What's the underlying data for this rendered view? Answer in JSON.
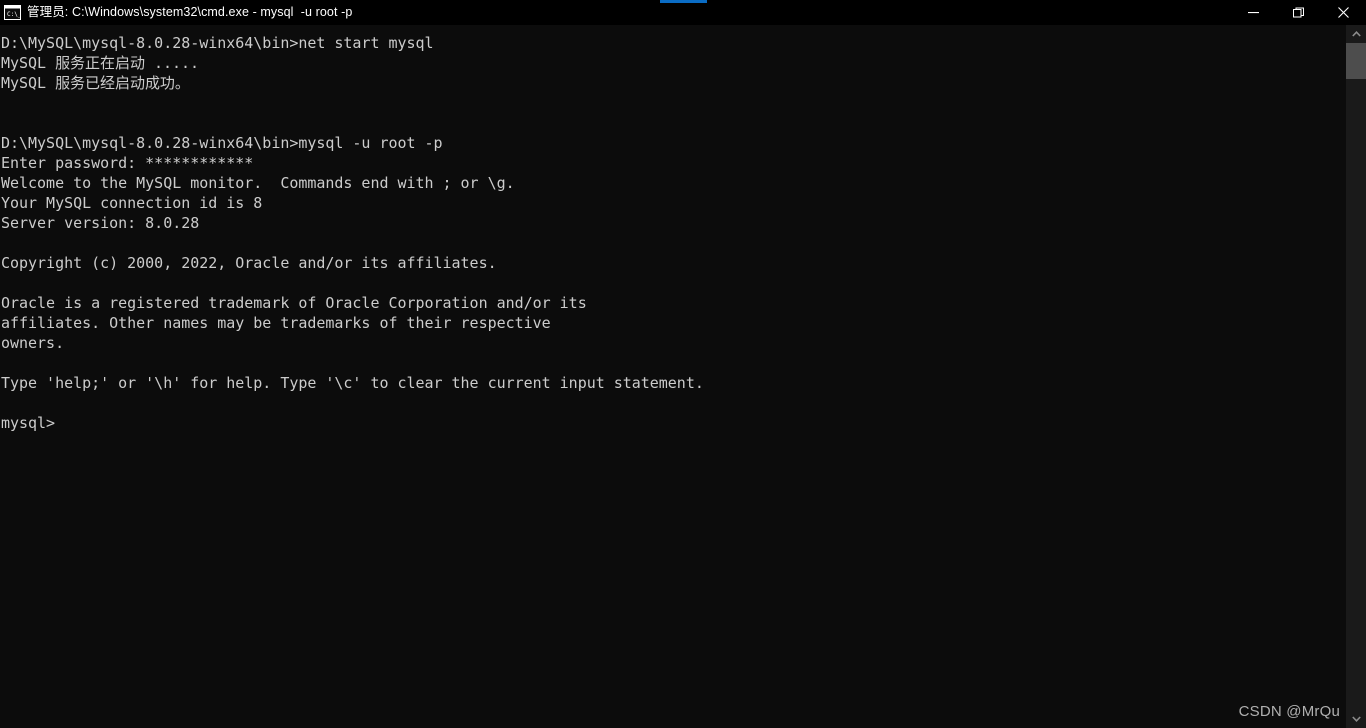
{
  "window": {
    "title": "管理员: C:\\Windows\\system32\\cmd.exe - mysql  -u root -p",
    "icon_name": "cmd-exe-icon",
    "titlebar_bg": "#000000",
    "body_bg": "#0c0c0c",
    "accent_color": "#0a6cc4",
    "text_color": "#cccccc",
    "controls": {
      "minimize_label": "Minimize",
      "restore_label": "Restore",
      "close_label": "Close"
    }
  },
  "terminal": {
    "prompt_symbol": "mysql>",
    "lines": [
      "D:\\MySQL\\mysql-8.0.28-winx64\\bin>net start mysql",
      "MySQL 服务正在启动 .....",
      "MySQL 服务已经启动成功。",
      "",
      "",
      "D:\\MySQL\\mysql-8.0.28-winx64\\bin>mysql -u root -p",
      "Enter password: ************",
      "Welcome to the MySQL monitor.  Commands end with ; or \\g.",
      "Your MySQL connection id is 8",
      "Server version: 8.0.28",
      "",
      "Copyright (c) 2000, 2022, Oracle and/or its affiliates.",
      "",
      "Oracle is a registered trademark of Oracle Corporation and/or its",
      "affiliates. Other names may be trademarks of their respective",
      "owners.",
      "",
      "Type 'help;' or '\\h' for help. Type '\\c' to clear the current input statement.",
      "",
      "mysql>"
    ],
    "commands": [
      "net start mysql",
      "mysql -u root -p"
    ],
    "working_directory": "D:\\MySQL\\mysql-8.0.28-winx64\\bin",
    "password_masked": "************",
    "password_length": 12,
    "connection_id": "8",
    "server_version": "8.0.28",
    "service_starting_message": "MySQL 服务正在启动 .....",
    "service_started_message": "MySQL 服务已经启动成功。"
  },
  "scrollbar": {
    "up_arrow_name": "chevron-up-icon",
    "down_arrow_name": "chevron-down-icon",
    "thumb_color": "#4d4d4d",
    "track_color": "#1a1a1a"
  },
  "watermark": {
    "text": "CSDN @MrQu"
  }
}
